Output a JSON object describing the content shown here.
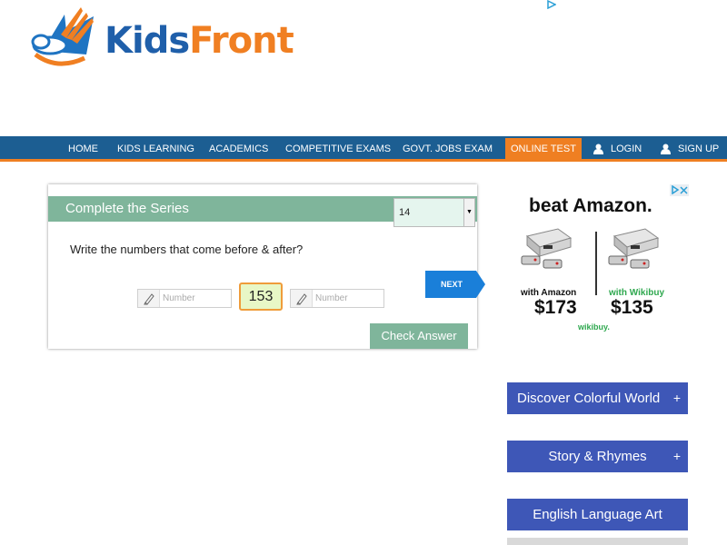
{
  "logo": {
    "kids": "Kids",
    "front": "Front"
  },
  "nav": {
    "items": [
      "HOME",
      "KIDS LEARNING",
      "ACADEMICS",
      "COMPETITIVE EXAMS",
      "GOVT. JOBS EXAM",
      "ONLINE TEST"
    ],
    "login": "LOGIN",
    "signup": "SIGN UP"
  },
  "quiz": {
    "title": "Complete the Series",
    "select_value": "14",
    "question": "Write the numbers that come before & after?",
    "before_placeholder": "Number",
    "after_placeholder": "Number",
    "given_number": "153",
    "next_label": "NEXT",
    "check_label": "Check Answer"
  },
  "ad": {
    "headline": "beat Amazon.",
    "left_label": "with Amazon",
    "left_price": "$173",
    "right_label": "with Wikibuy",
    "right_price": "$135",
    "brand": "wikibuy."
  },
  "side_buttons": [
    {
      "label": "Discover Colorful World",
      "plus": "+"
    },
    {
      "label": "Story & Rhymes",
      "plus": "+"
    },
    {
      "label": "English Language Art",
      "plus": ""
    }
  ],
  "colors": {
    "nav_bg": "#1c5e92",
    "accent": "#ef7f22",
    "quiz_green": "#7fb59b",
    "side_blue": "#3e57b7",
    "next_blue": "#1a7fd9"
  },
  "icons": [
    "kidsfront-logo-icon",
    "adchoices-icon",
    "user-icon",
    "pencil-icon",
    "chevron-down-icon",
    "close-icon",
    "plus-icon"
  ]
}
